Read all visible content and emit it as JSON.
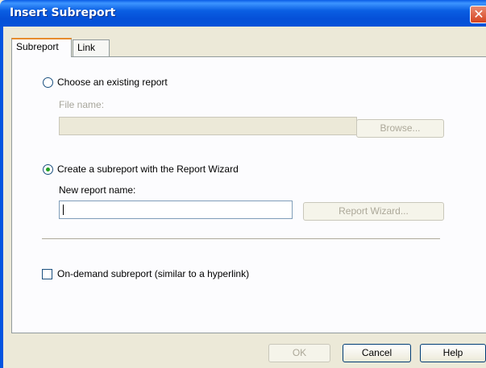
{
  "window": {
    "title": "Insert Subreport",
    "close_glyph": "✕"
  },
  "tabs": [
    {
      "label": "Subreport",
      "active": true
    },
    {
      "label": "Link",
      "active": false
    }
  ],
  "existing": {
    "radio_label": "Choose an existing report",
    "selected": false,
    "file_name_label": "File name:",
    "file_name_value": "",
    "browse_label": "Browse..."
  },
  "wizard": {
    "radio_label": "Create a subreport with the Report Wizard",
    "selected": true,
    "new_name_label": "New report name:",
    "new_name_value": "",
    "wizard_button_label": "Report Wizard..."
  },
  "on_demand": {
    "label": "On-demand subreport (similar to a hyperlink)",
    "checked": false
  },
  "footer": {
    "ok_label": "OK",
    "cancel_label": "Cancel",
    "help_label": "Help"
  },
  "colors": {
    "title_bar": "#0a5ce6",
    "dialog_bg": "#ece9d8",
    "radio_dot": "#21a121",
    "tab_accent": "#e68b2c"
  }
}
